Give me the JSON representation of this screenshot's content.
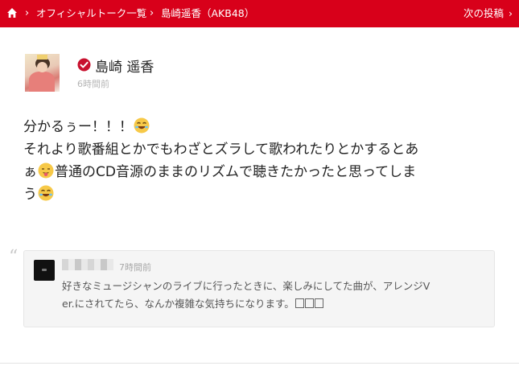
{
  "header": {
    "breadcrumbs": [
      "オフィシャルトーク一覧",
      "島崎遥香（AKB48）"
    ],
    "next_post": "次の投稿",
    "brand_color": "#d8001a"
  },
  "post": {
    "author": "島崎 遥香",
    "time": "6時間前",
    "lines": [
      {
        "parts": [
          "分かるぅー！！！"
        ],
        "emoji": [
          "laughing-emoji"
        ]
      },
      {
        "parts": [
          "それより歌番組とかでもわざとズラして歌われたりとかするとあ"
        ]
      },
      {
        "parts": [
          "ぁ",
          "普通のCD音源のままのリズムで聴きたかったと思ってしま"
        ],
        "emoji": [
          "tongue-out-emoji"
        ]
      },
      {
        "parts": [
          "う"
        ],
        "emoji": [
          "laughing-emoji"
        ]
      }
    ]
  },
  "reply": {
    "time": "7時間前",
    "line1": "好きなミュージシャンのライブに行ったときに、楽しみにしてた曲が、アレンジV",
    "line2": "er.にされてたら、なんか複雑な気持ちになります。"
  }
}
